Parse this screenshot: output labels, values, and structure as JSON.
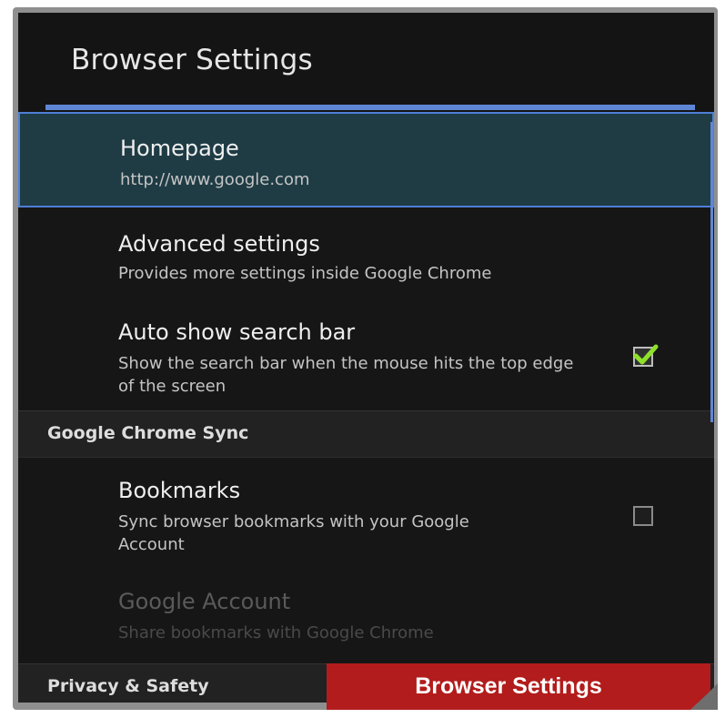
{
  "header": {
    "title": "Browser Settings"
  },
  "rows": [
    {
      "title": "Homepage",
      "subtitle": "http://www.google.com"
    },
    {
      "title": "Advanced settings",
      "subtitle": "Provides more settings inside Google Chrome"
    },
    {
      "title": "Auto show search bar",
      "subtitle": "Show the search bar when the mouse hits the top edge of the screen",
      "checked": true
    }
  ],
  "sections": [
    {
      "label": "Google Chrome Sync",
      "rows": [
        {
          "title": "Bookmarks",
          "subtitle": "Sync browser bookmarks with your Google Account",
          "checked": false
        },
        {
          "title": "Google Account",
          "subtitle": "Share bookmarks with Google Chrome",
          "disabled": true
        }
      ]
    },
    {
      "label": "Privacy & Safety"
    }
  ],
  "caption": {
    "text": "Browser Settings"
  },
  "colors": {
    "accent": "#5f86d4",
    "selected_bg": "#1f3c45",
    "check": "#8ee02a",
    "caption_bg": "#b21c1c"
  },
  "icons": {
    "check": "checkmark-icon"
  }
}
